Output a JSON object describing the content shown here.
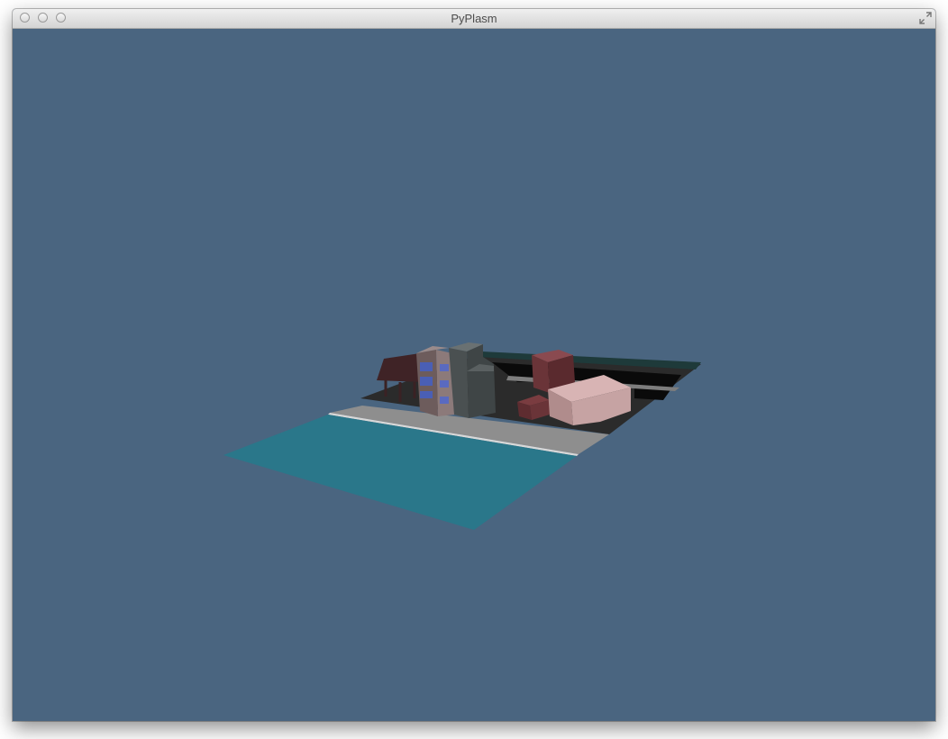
{
  "window": {
    "title": "PyPlasm"
  },
  "titlebar_buttons": [
    {
      "name": "close-button",
      "icon": "traffic-light-close"
    },
    {
      "name": "minimize-button",
      "icon": "traffic-light-minimize"
    },
    {
      "name": "zoom-button",
      "icon": "traffic-light-zoom"
    }
  ],
  "fullscreen_button": {
    "icon": "fullscreen-arrows-icon"
  },
  "viewport": {
    "background_color": "#4a6580",
    "scene": "3d-city-block-model"
  },
  "colors": {
    "water": "#2a778a",
    "sidewalk": "#8f8f8f",
    "ground": "#2a2a2a",
    "building_pink": "#c9a6a6",
    "building_maroon": "#6a3438",
    "building_gray": "#4f5556",
    "building_brick_blue": "#6d6c8a"
  }
}
